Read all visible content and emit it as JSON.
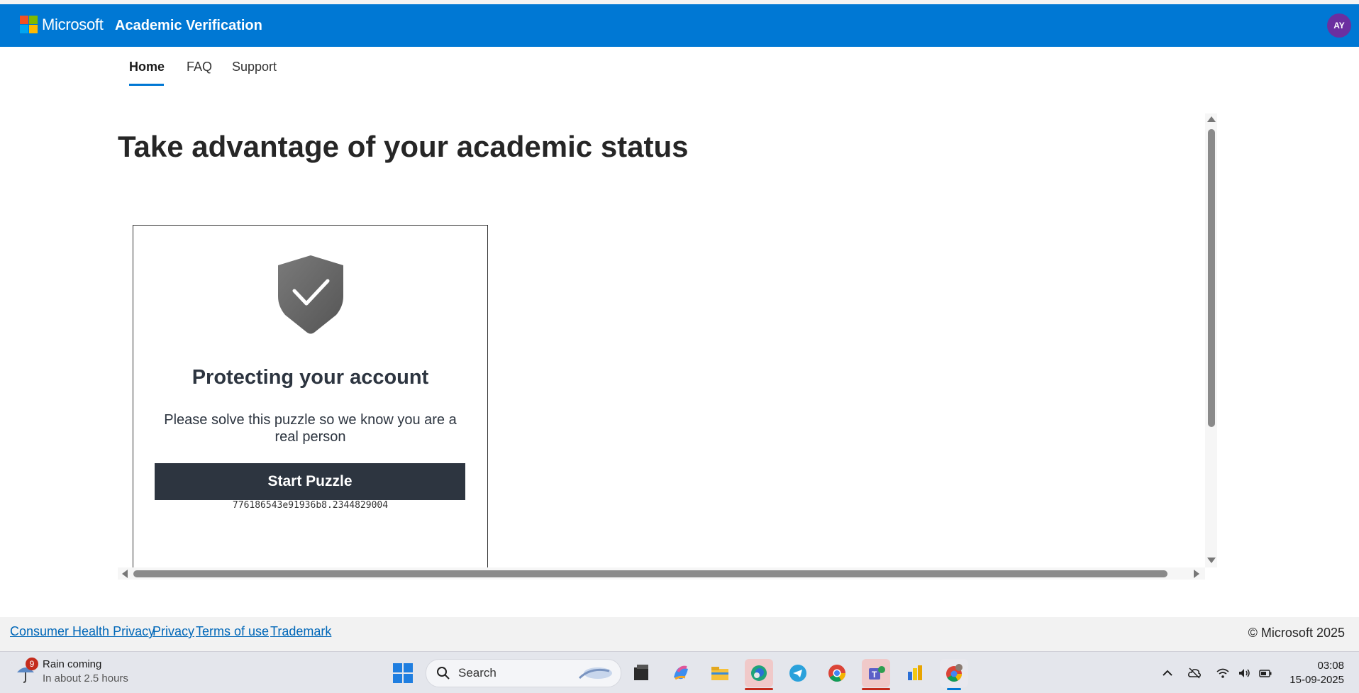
{
  "header": {
    "brand": "Microsoft",
    "app_title": "Academic Verification",
    "avatar_initials": "AY",
    "bg_color": "#0078d4"
  },
  "nav": {
    "items": [
      {
        "label": "Home",
        "active": true
      },
      {
        "label": "FAQ",
        "active": false
      },
      {
        "label": "Support",
        "active": false
      }
    ]
  },
  "main": {
    "headline": "Take advantage of your academic status"
  },
  "puzzle_card": {
    "icon": "shield-check-icon",
    "title": "Protecting your account",
    "description": "Please solve this puzzle so we know you are a real person",
    "button_label": "Start Puzzle",
    "session_id": "776186543e91936b8.2344829004"
  },
  "footer": {
    "links": [
      "Consumer Health Privacy",
      "Privacy",
      "Terms of use",
      "Trademark"
    ],
    "copyright": "© Microsoft 2025"
  },
  "taskbar": {
    "weather": {
      "badge": "9",
      "title": "Rain coming",
      "subtitle": "In about 2.5 hours"
    },
    "search_placeholder": "Search",
    "apps": [
      "file-manager-icon",
      "copilot-icon",
      "file-explorer-icon",
      "edge-icon",
      "telegram-icon",
      "chrome-icon",
      "teams-icon",
      "power-bi-icon",
      "chrome-profile-icon"
    ],
    "clock": {
      "time": "03:08",
      "date": "15-09-2025"
    }
  }
}
